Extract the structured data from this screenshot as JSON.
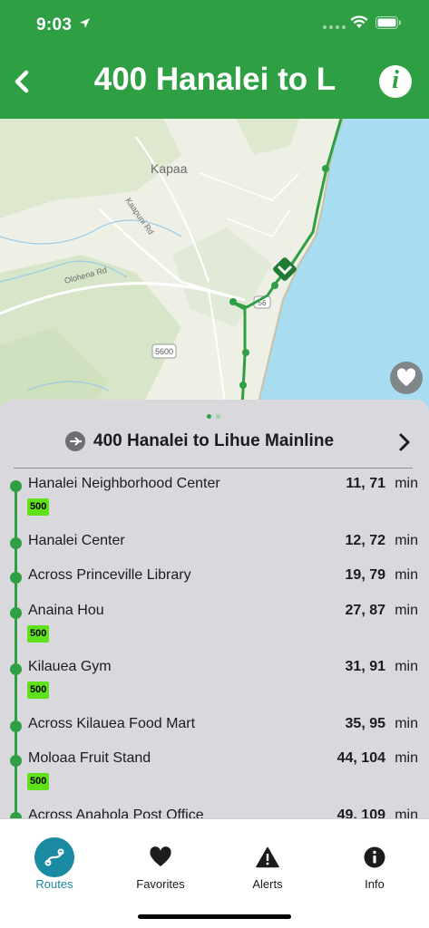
{
  "status_bar": {
    "time": "9:03"
  },
  "header": {
    "title": "400 Hanalei to L"
  },
  "map": {
    "labels": {
      "town": "Kapaa",
      "road1": "Kaapuni Rd",
      "road2": "Olohena Rd",
      "shield": "5600",
      "shield2": "56"
    }
  },
  "sheet": {
    "route_name": "400 Hanalei to Lihue Mainline",
    "stops": [
      {
        "name": "Hanalei Neighborhood Center",
        "times": "11, 71",
        "unit": "min",
        "badge": "500"
      },
      {
        "name": "Hanalei Center",
        "times": "12, 72",
        "unit": "min",
        "badge": ""
      },
      {
        "name": "Across Princeville Library",
        "times": "19, 79",
        "unit": "min",
        "badge": ""
      },
      {
        "name": "Anaina Hou",
        "times": "27, 87",
        "unit": "min",
        "badge": "500"
      },
      {
        "name": "Kilauea Gym",
        "times": "31, 91",
        "unit": "min",
        "badge": "500"
      },
      {
        "name": "Across Kilauea Food Mart",
        "times": "35, 95",
        "unit": "min",
        "badge": ""
      },
      {
        "name": "Moloaa Fruit Stand",
        "times": "44, 104",
        "unit": "min",
        "badge": "500"
      },
      {
        "name": "Across Anahola Post Office",
        "times": "49, 109",
        "unit": "min",
        "badge": ""
      }
    ]
  },
  "tabs": [
    {
      "label": "Routes",
      "icon": "route-icon",
      "active": true
    },
    {
      "label": "Favorites",
      "icon": "heart-icon",
      "active": false
    },
    {
      "label": "Alerts",
      "icon": "alert-triangle-icon",
      "active": false
    },
    {
      "label": "Info",
      "icon": "info-icon",
      "active": false
    }
  ],
  "colors": {
    "brand_green": "#2ea043",
    "accent_teal": "#1a8aa3",
    "badge_lime": "#5fe21c",
    "ocean": "#a8dcf0"
  }
}
